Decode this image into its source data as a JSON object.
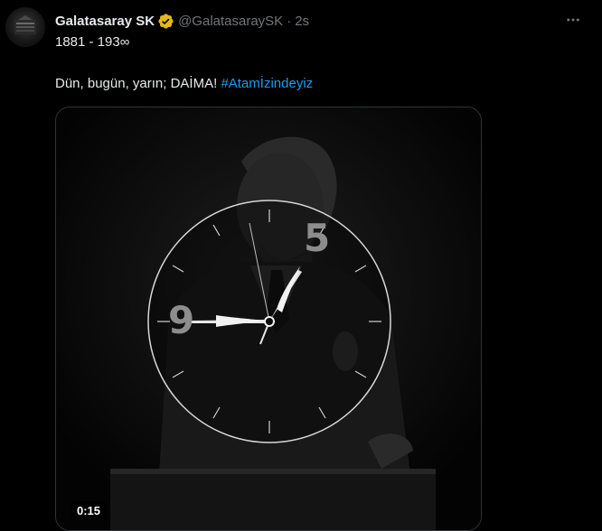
{
  "tweet": {
    "author_name": "Galatasaray SK",
    "author_handle": "@GalatasaraySK",
    "separator": "·",
    "timestamp": "2s",
    "line1": "1881 - 193∞",
    "line2_text": "Dün, bugün, yarın; DAİMA!",
    "hashtag": "#Atamİzindeyiz",
    "verified_badge_icon": "verified-badge-icon",
    "verified_color": "#e2b719",
    "hashtag_color": "#1d9bf0"
  },
  "media": {
    "clock_numerals": [
      "5",
      "9"
    ],
    "duration": "0:15"
  },
  "icons": {
    "more": "more-dots-icon",
    "avatar": "club-logo"
  }
}
